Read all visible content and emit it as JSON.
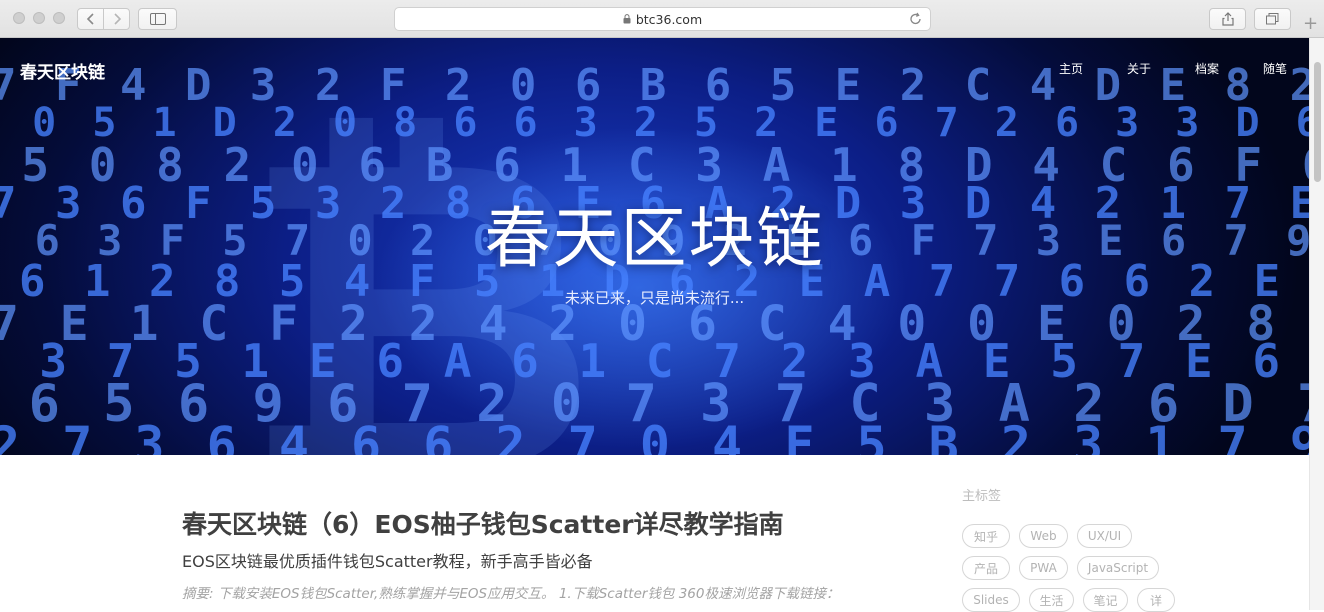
{
  "browser": {
    "url": "btc36.com"
  },
  "site": {
    "brand": "春天区块链",
    "nav": [
      "主页",
      "关于",
      "档案",
      "随笔"
    ],
    "hero_title": "春天区块链",
    "hero_subtitle": "未来已来，只是尚未流行..."
  },
  "post": {
    "title": "春天区块链（6）EOS柚子钱包Scatter详尽教学指南",
    "subtitle": "EOS区块链最优质插件钱包Scatter教程，新手高手皆必备",
    "excerpt": "摘要: 下载安装EOS钱包Scatter,熟练掌握并与EOS应用交互。 1.下载Scatter钱包 360极速浏览器下载链接："
  },
  "sidebar": {
    "title": "主标签",
    "tags": [
      "知乎",
      "Web",
      "UX/UI",
      "产品",
      "PWA",
      "JavaScript",
      "Slides",
      "生活",
      "笔记",
      "详"
    ]
  },
  "colors": {
    "hero_blue": "#0c1e86",
    "digit_blue": "#2f6bff",
    "text_dark": "#404040",
    "tag_border": "#d6d6d6"
  }
}
